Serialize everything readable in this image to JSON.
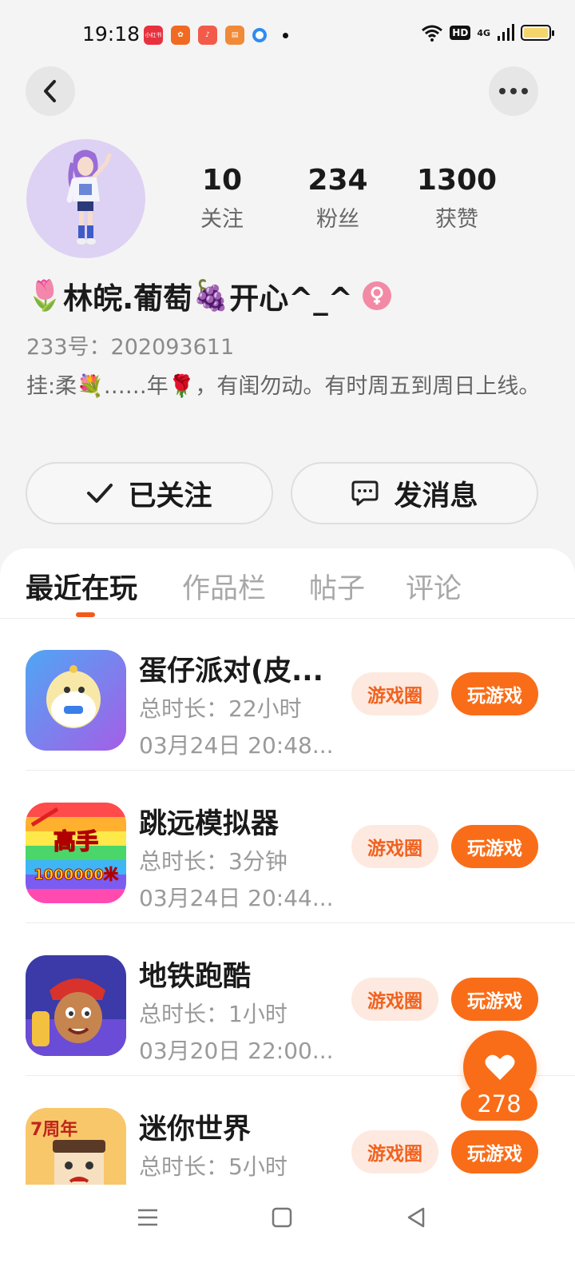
{
  "status_bar": {
    "time": "19:18",
    "app_badge": "小红书",
    "hd": "HD",
    "network": "4G"
  },
  "profile": {
    "nickname_prefix_emoji": "🌷",
    "nickname_main": "林皖.葡萄",
    "nickname_mid_emoji": "🍇",
    "nickname_suffix": "开心^_^",
    "gender": "female",
    "user_id": "233号：202093611",
    "bio": "挂:柔💐……年🌹，有闺勿动。有时周五到周日上线。",
    "stats": [
      {
        "value": "10",
        "label": "关注"
      },
      {
        "value": "234",
        "label": "粉丝"
      },
      {
        "value": "1300",
        "label": "获赞"
      }
    ],
    "follow_label": "已关注",
    "message_label": "发消息"
  },
  "tabs": [
    {
      "label": "最近在玩",
      "active": true
    },
    {
      "label": "作品栏",
      "active": false
    },
    {
      "label": "帖子",
      "active": false
    },
    {
      "label": "评论",
      "active": false
    }
  ],
  "games": [
    {
      "name": "蛋仔派对(皮...",
      "duration": "总时长：22小时",
      "last_played": "03月24日 20:48...",
      "circle_label": "游戏圈",
      "play_label": "玩游戏",
      "icon": "eggy-party-icon"
    },
    {
      "name": "跳远模拟器",
      "duration": "总时长：3分钟",
      "last_played": "03月24日 20:44...",
      "circle_label": "游戏圈",
      "play_label": "玩游戏",
      "icon": "long-jump-icon",
      "icon_text_top": "高手",
      "icon_text_bottom": "1000000米"
    },
    {
      "name": "地铁跑酷",
      "duration": "总时长：1小时",
      "last_played": "03月20日 22:00...",
      "circle_label": "游戏圈",
      "play_label": "玩游戏",
      "icon": "subway-surfers-icon"
    },
    {
      "name": "迷你世界",
      "duration": "总时长：5小时",
      "last_played": "",
      "circle_label": "游戏圈",
      "play_label": "玩游戏",
      "icon": "mini-world-icon",
      "icon_text": "7周年"
    }
  ],
  "like": {
    "count": "278"
  },
  "colors": {
    "accent": "#f96d18",
    "accent_light": "#fde9df",
    "avatar_bg": "#ddd2f3"
  }
}
